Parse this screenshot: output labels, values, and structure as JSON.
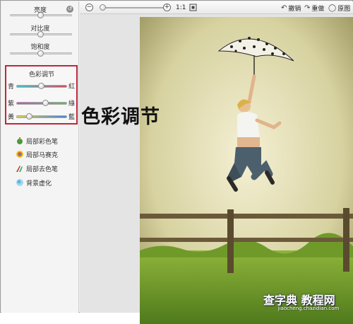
{
  "adjustments": {
    "brightness_label": "亮度",
    "contrast_label": "对比度",
    "saturation_label": "饱和度"
  },
  "color_balance": {
    "title": "色彩调节",
    "rows": [
      {
        "left": "青",
        "right": "紅"
      },
      {
        "left": "紫",
        "right": "綠"
      },
      {
        "left": "黃",
        "right": "藍"
      }
    ]
  },
  "tools": [
    {
      "label": "局部彩色笔",
      "icon": "color-brush-icon"
    },
    {
      "label": "局部马赛克",
      "icon": "mosaic-icon"
    },
    {
      "label": "局部去色笔",
      "icon": "desaturate-brush-icon"
    },
    {
      "label": "背景虚化",
      "icon": "background-blur-icon"
    }
  ],
  "toolbar": {
    "actual_size": "1:1",
    "undo": "撤销",
    "redo": "重做",
    "original": "原图"
  },
  "annotation": "色彩调节",
  "watermark": {
    "main": "查字典 教程网",
    "sub": "jiaocheng.chazidian.com"
  },
  "colors": {
    "highlight_border": "#c0263a"
  }
}
